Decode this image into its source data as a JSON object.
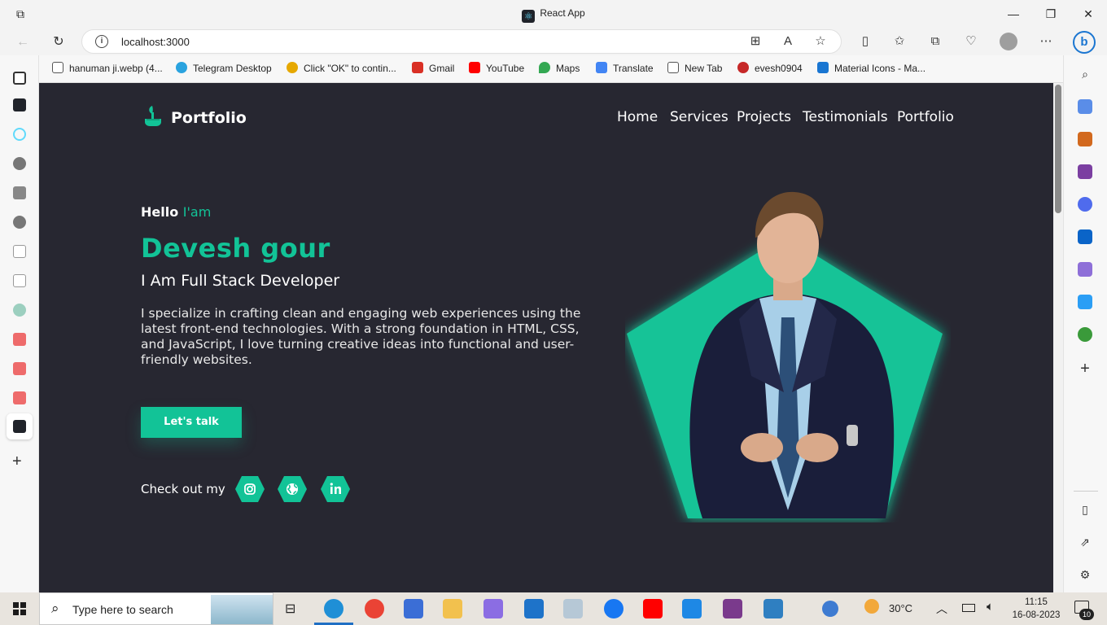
{
  "browser": {
    "window_title": "React App",
    "url": "localhost:3000",
    "bookmarks": [
      {
        "label": "hanuman ji.webp (4...",
        "color": "#555555"
      },
      {
        "label": "Telegram Desktop",
        "color": "#2aa3df"
      },
      {
        "label": "Click \"OK\" to contin...",
        "color": "#e6a800"
      },
      {
        "label": "Gmail",
        "color": "#d93025"
      },
      {
        "label": "YouTube",
        "color": "#ff0000"
      },
      {
        "label": "Maps",
        "color": "#34a853"
      },
      {
        "label": "Translate",
        "color": "#4285f4"
      },
      {
        "label": "New Tab",
        "color": "#555555"
      },
      {
        "label": "evesh0904",
        "color": "#c62828"
      },
      {
        "label": "Material Icons - Ma...",
        "color": "#1976d2"
      }
    ]
  },
  "site": {
    "brand": "Portfolio",
    "nav": [
      "Home",
      "Services",
      "Projects",
      "Testimonials",
      "Portfolio"
    ],
    "hero": {
      "hello": "Hello",
      "iam": "I'am",
      "name": "Devesh gour",
      "role": "I Am Full Stack Developer",
      "description": "I specialize in crafting clean and engaging web experiences using the latest front-end technologies. With a strong foundation in HTML, CSS, and JavaScript, I love turning creative ideas into functional and user-friendly websites.",
      "cta": "Let's talk",
      "checkout": "Check out my",
      "socials": [
        "instagram-icon",
        "globe-icon",
        "linkedin-icon"
      ]
    },
    "accent": "#12c397",
    "background": "#272731"
  },
  "taskbar": {
    "search_placeholder": "Type here to search",
    "temperature": "30°C",
    "time": "11:15",
    "date": "16-08-2023",
    "notification_count": "10"
  }
}
